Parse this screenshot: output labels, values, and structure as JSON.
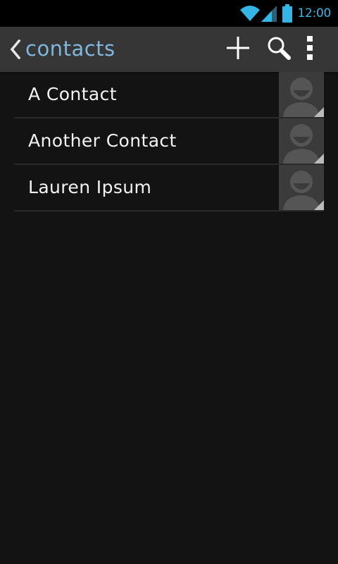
{
  "status_bar": {
    "time": "12:00",
    "icons": [
      "wifi-icon",
      "cell-signal-icon",
      "battery-icon"
    ],
    "accent_color": "#33b5e5"
  },
  "action_bar": {
    "title": "contacts",
    "title_color": "#7fb7dd",
    "actions": [
      "add-icon",
      "search-icon",
      "overflow-menu-icon"
    ]
  },
  "contacts": [
    {
      "name": "A Contact"
    },
    {
      "name": "Another Contact"
    },
    {
      "name": "Lauren Ipsum"
    }
  ]
}
